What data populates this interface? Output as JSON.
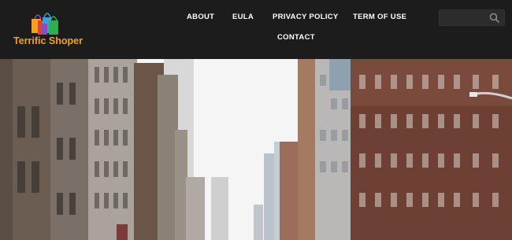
{
  "brand": {
    "name": "Terrific Shoper",
    "logo_icon": "shopping-bags-icon",
    "accent_color": "#f4a11e"
  },
  "nav": {
    "items": [
      {
        "label": "ABOUT"
      },
      {
        "label": "EULA"
      },
      {
        "label": "PRIVACY POLICY"
      },
      {
        "label": "TERM OF USE"
      },
      {
        "label": "CONTACT"
      }
    ]
  },
  "search": {
    "placeholder": "",
    "icon": "search-icon"
  },
  "hero": {
    "image": "city-street-buildings-photo"
  }
}
